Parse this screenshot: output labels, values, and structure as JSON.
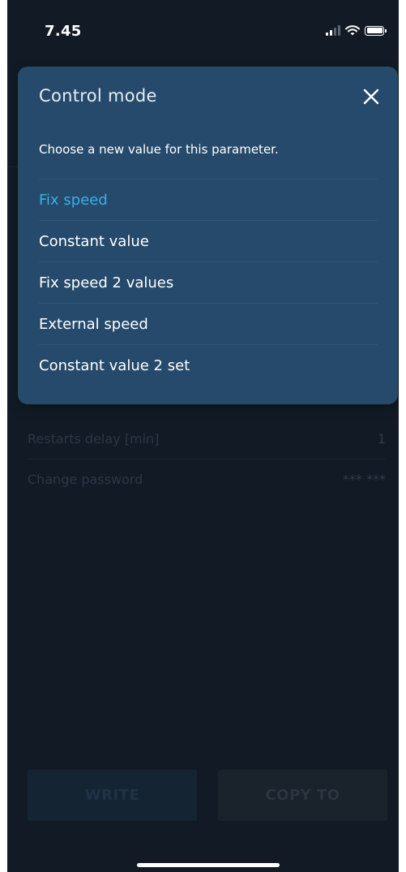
{
  "status_bar": {
    "time": "7.45",
    "icons": [
      "signal-icon",
      "wifi-icon",
      "battery-icon"
    ]
  },
  "modal": {
    "title": "Control mode",
    "description": "Choose a new value for this parameter.",
    "close_icon": "close-icon",
    "options": [
      {
        "label": "Fix speed",
        "selected": true
      },
      {
        "label": "Constant value",
        "selected": false
      },
      {
        "label": "Fix speed 2 values",
        "selected": false
      },
      {
        "label": "External speed",
        "selected": false
      },
      {
        "label": "Constant value 2 set",
        "selected": false
      }
    ]
  },
  "background": {
    "rows": [
      {
        "label": "Restarts delay [min]",
        "value": "1"
      },
      {
        "label": "Change password",
        "value": "*** ***"
      }
    ],
    "buttons": {
      "write": "WRITE",
      "copy_to": "COPY TO"
    }
  },
  "colors": {
    "screen_bg": "#121b25",
    "modal_bg": "#254a6b",
    "selected_option": "#3aaee6",
    "text": "#ffffff"
  }
}
